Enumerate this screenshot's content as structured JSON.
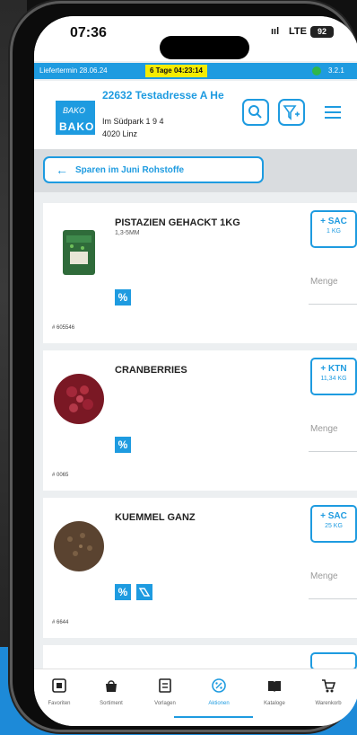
{
  "status_bar": {
    "time": "07:36",
    "signal": "ııl",
    "network": "LTE",
    "battery": "92"
  },
  "info_bar": {
    "delivery": "Liefertermin 28.06.24",
    "countdown": "6 Tage 04:23:14",
    "version": "3.2.1",
    "status_color": "#2fb74a"
  },
  "header": {
    "logo_script": "BAKO",
    "logo_text": "BAKO",
    "address_title": "22632 Testadresse A He",
    "address_street": "Im Südpark 1 9 4",
    "address_city": "4020  Linz"
  },
  "nav": {
    "back_label": "Sparen im Juni Rohstoffe"
  },
  "products": [
    {
      "name": "PISTAZIEN GEHACKT 1KG",
      "sub": "1,3-5MM",
      "unit": "+ SAC",
      "qty": "1 KG",
      "menge": "Menge",
      "article": "# 605546",
      "image": "pistachio-bag",
      "badges": [
        "%"
      ]
    },
    {
      "name": "CRANBERRIES",
      "sub": "",
      "unit": "+ KTN",
      "qty": "11,34 KG",
      "menge": "Menge",
      "article": "# 0065",
      "image": "cranberries-bowl",
      "badges": [
        "%"
      ]
    },
    {
      "name": "KUEMMEL GANZ",
      "sub": "",
      "unit": "+ SAC",
      "qty": "25 KG",
      "menge": "Menge",
      "article": "# 6644",
      "image": "caraway-seeds",
      "badges": [
        "%",
        "discount-tag"
      ]
    }
  ],
  "bottom_nav": [
    {
      "label": "Favoriten",
      "icon": "star-box-icon"
    },
    {
      "label": "Sortiment",
      "icon": "bag-icon"
    },
    {
      "label": "Vorlagen",
      "icon": "template-icon"
    },
    {
      "label": "Aktionen",
      "icon": "percent-circle-icon",
      "active": true
    },
    {
      "label": "Kataloge",
      "icon": "book-icon"
    },
    {
      "label": "Warenkorb",
      "icon": "cart-icon"
    }
  ],
  "colors": {
    "accent": "#1e9be0",
    "highlight": "#f5ec00",
    "background": "#eceff1"
  }
}
